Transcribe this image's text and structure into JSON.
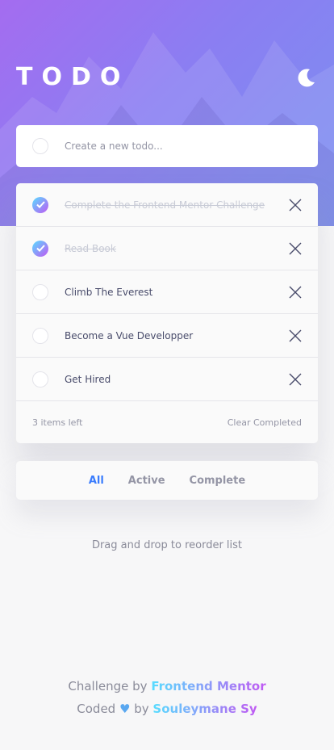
{
  "header": {
    "title": "TODO",
    "theme_toggle_icon": "moon-icon"
  },
  "create": {
    "placeholder": "Create a new todo..."
  },
  "todos": [
    {
      "text": "Complete the Frontend Mentor Challenge",
      "completed": true
    },
    {
      "text": "Read Book",
      "completed": true
    },
    {
      "text": "Climb The Everest",
      "completed": false
    },
    {
      "text": "Become a Vue Developper",
      "completed": false
    },
    {
      "text": "Get Hired",
      "completed": false
    }
  ],
  "footer": {
    "items_left": "3 items left",
    "clear_label": "Clear Completed"
  },
  "filters": {
    "all": "All",
    "active": "Active",
    "complete": "Complete",
    "selected": "All"
  },
  "hint": "Drag and drop to reorder list",
  "attribution": {
    "challenge_prefix": "Challenge by",
    "challenge_link": "Frontend Mentor",
    "coded_prefix": "Coded",
    "heart": "♥",
    "by": "by",
    "author_link": "Souleymane Sy"
  },
  "colors": {
    "accent": "#3a7cfd",
    "check_gradient_start": "#57ddff",
    "check_gradient_end": "#c058f3"
  }
}
